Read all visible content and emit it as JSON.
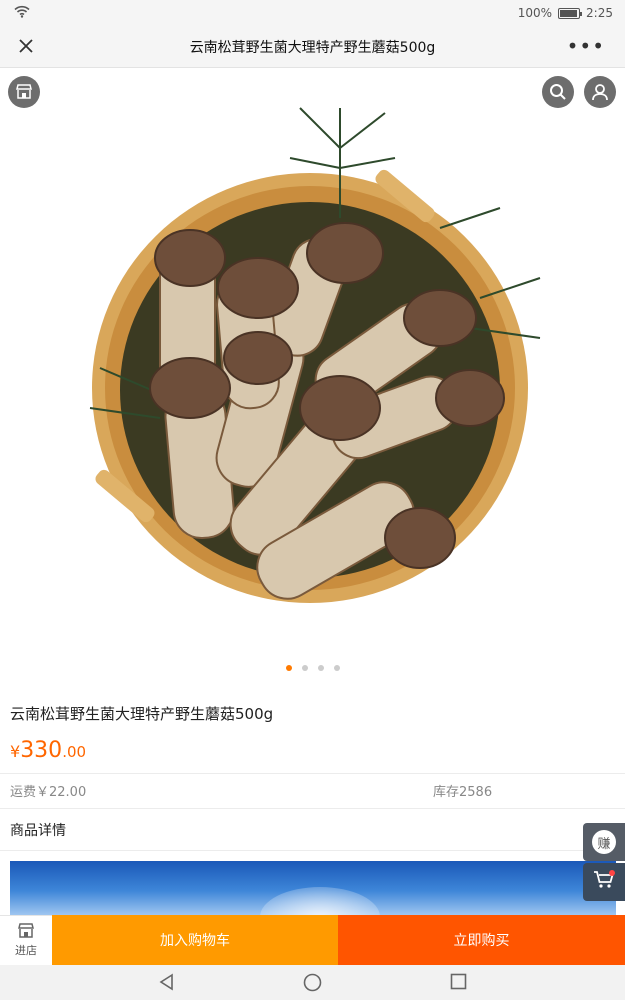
{
  "status_bar": {
    "wifi_icon": "wifi-icon",
    "battery_percent": "100%",
    "time": "2:25"
  },
  "nav": {
    "title": "云南松茸野生菌大理特产野生蘑菇500g",
    "close_icon": "close-icon",
    "more_icon": "more-icon"
  },
  "hero": {
    "image_alt": "product-photo",
    "store_icon": "store-icon",
    "search_icon": "search-icon",
    "user_icon": "user-icon",
    "page_count": 4,
    "active_page": 1
  },
  "product": {
    "title": "云南松茸野生菌大理特产野生蘑菇500g",
    "price_currency": "¥",
    "price_integer": "330",
    "price_decimal": ".00",
    "shipping": "运费￥22.00",
    "stock": "库存2586",
    "detail_label": "商品详情"
  },
  "floating": {
    "earn_label": "赚",
    "cart_icon": "cart-icon"
  },
  "bottom_bar": {
    "store_label": "进店",
    "add_to_cart": "加入购物车",
    "buy_now": "立即购买"
  },
  "system_nav": {
    "back_icon": "back-icon",
    "home_icon": "home-icon",
    "recent_icon": "recent-apps-icon"
  },
  "colors": {
    "accent_orange": "#ff6600",
    "add_cart_bg": "#ff9a00",
    "buy_now_bg": "#ff5500",
    "active_dot": "#ff7a00"
  }
}
